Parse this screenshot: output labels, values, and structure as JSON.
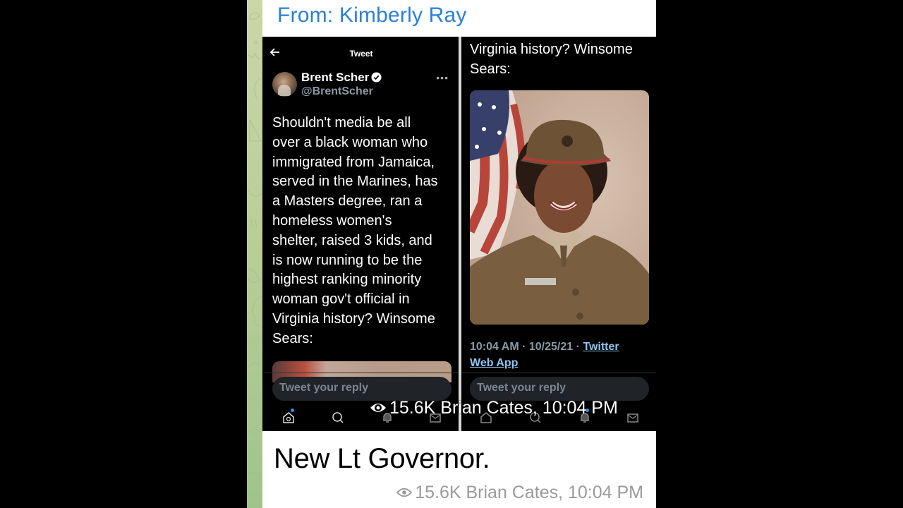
{
  "message": {
    "forward_header": "From: Kimberly Ray",
    "text": "New Lt Governor.",
    "views": "15.6K",
    "author": "Brian Cates",
    "time": "10:04 PM",
    "meta_line": "15.6K Brian Cates, 10:04 PM",
    "eye_icon": "eye-icon"
  },
  "overlay_caption": "15.6K Brian Cates, 10:04 PM",
  "tweet_left": {
    "header_title": "Tweet",
    "back_icon": "arrow-left-icon",
    "author_name": "Brent Scher",
    "author_handle": "@BrentScher",
    "verified": true,
    "more_icon": "ellipsis-icon",
    "body_lines": [
      "Shouldn't media be all",
      "over a black woman who",
      "immigrated from Jamaica,",
      "served in the Marines, has",
      "a Masters degree, ran a",
      "homeless women's",
      "shelter, raised 3 kids, and",
      "is now running to be the",
      "highest ranking minority",
      "woman gov't official in",
      "Virginia history? Winsome",
      "Sears:"
    ],
    "reply_placeholder": "Tweet your reply",
    "tabs": [
      "home-icon",
      "search-icon",
      "bell-icon",
      "mail-icon"
    ]
  },
  "tweet_right": {
    "body_lines": [
      "Virginia history? Winsome",
      "Sears:"
    ],
    "photo_alt": "Portrait of woman in Marine Corps uniform in front of US flag",
    "timestamp": "10:04 AM · 10/25/21 · ",
    "source_link_line1": "Twitter",
    "source_link_line2": "Web App",
    "reply_placeholder": "Tweet your reply",
    "tabs": [
      "home-icon",
      "search-icon",
      "bell-icon",
      "mail-icon"
    ]
  },
  "colors": {
    "forward_header": "#2a7fd9",
    "link": "#8cc4f0",
    "twitter_blue": "#1d9bf0",
    "meta_gray": "#9a9a9a"
  }
}
